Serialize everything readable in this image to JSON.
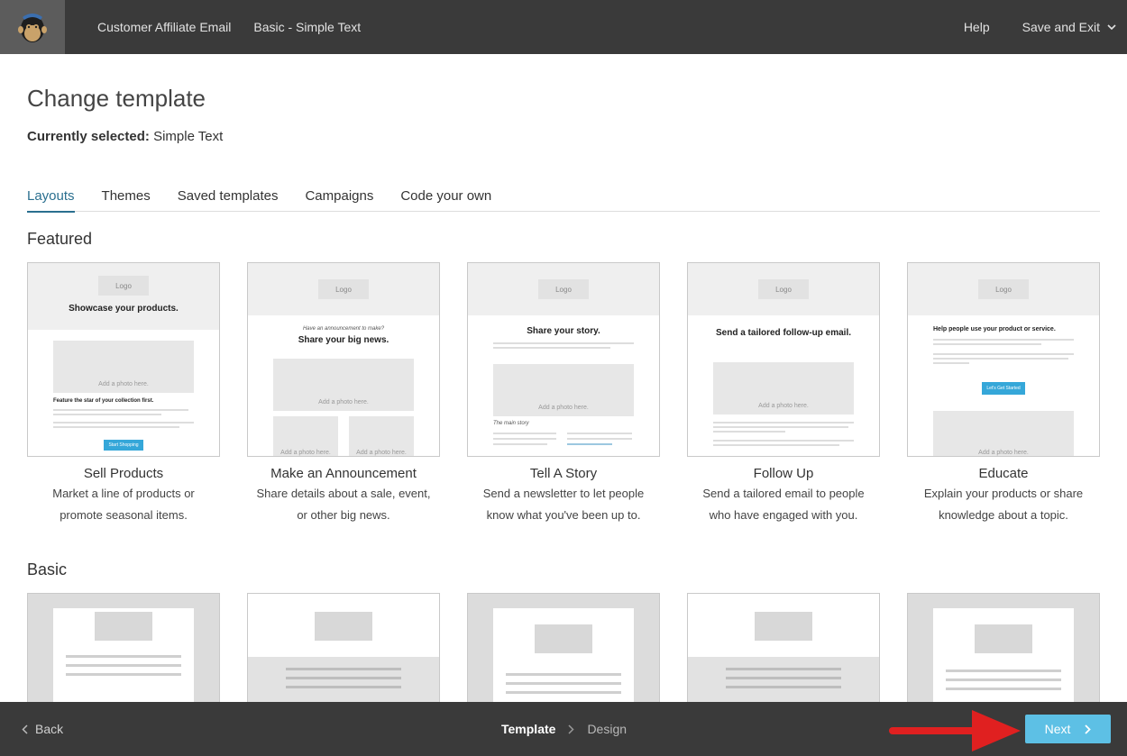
{
  "topbar": {
    "crumb1": "Customer Affiliate Email",
    "crumb2": "Basic - Simple Text",
    "help": "Help",
    "save_exit": "Save and Exit"
  },
  "page": {
    "title": "Change template",
    "current_label": "Currently selected:",
    "current_value": "Simple Text"
  },
  "tabs": [
    "Layouts",
    "Themes",
    "Saved templates",
    "Campaigns",
    "Code your own"
  ],
  "featured": {
    "title": "Featured",
    "cards": [
      {
        "title": "Sell Products",
        "desc1": "Market a line of products or",
        "desc2": "promote seasonal items.",
        "headline": "Showcase your products.",
        "sub": "Feature the star of your collection first.",
        "btn": "Start Shopping"
      },
      {
        "title": "Make an Announcement",
        "desc1": "Share details about a sale, event,",
        "desc2": "or other big news.",
        "kicker": "Have an announcement to make?",
        "headline": "Share your big news."
      },
      {
        "title": "Tell A Story",
        "desc1": "Send a newsletter to let people",
        "desc2": "know what you've been up to.",
        "headline": "Share your story.",
        "sub": "The main story"
      },
      {
        "title": "Follow Up",
        "desc1": "Send a tailored email to people",
        "desc2": "who have engaged with you.",
        "headline": "Send a tailored follow-up email."
      },
      {
        "title": "Educate",
        "desc1": "Explain your products or share",
        "desc2": "knowledge about a topic.",
        "headline": "Help people use your product or service.",
        "btn": "Let's Get Started"
      }
    ],
    "logo_text": "Logo",
    "photo_text": "Add a photo here."
  },
  "basic": {
    "title": "Basic"
  },
  "bottombar": {
    "back": "Back",
    "step_current": "Template",
    "step_next": "Design",
    "next": "Next"
  },
  "colors": {
    "accent": "#2a6f8f",
    "next_button": "#5dc0e5",
    "bar": "#3a3a3a",
    "arrow": "#e02020"
  }
}
